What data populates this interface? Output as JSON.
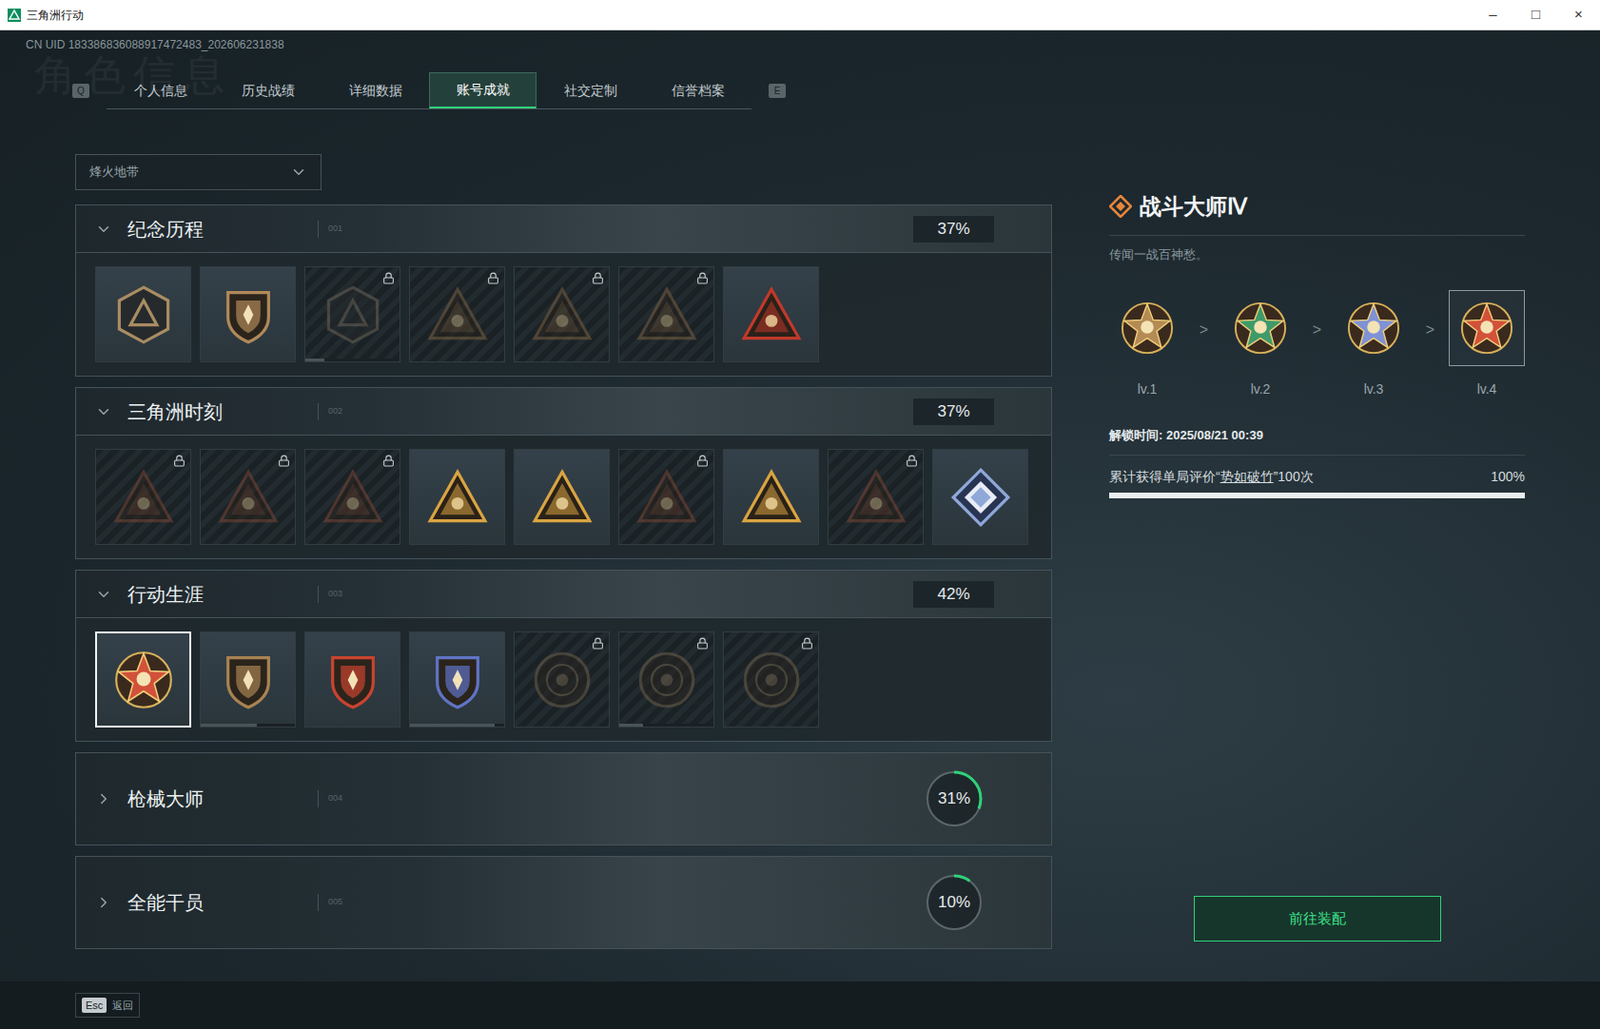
{
  "window": {
    "title": "三角洲行动",
    "controls": [
      "–",
      "□",
      "×"
    ]
  },
  "uid": "CN UID 183386836088917472483_202606231838",
  "watermark": "角色信息",
  "tabs": {
    "prev_key": "Q",
    "next_key": "E",
    "items": [
      {
        "label": "个人信息",
        "selected": false
      },
      {
        "label": "历史战绩",
        "selected": false
      },
      {
        "label": "详细数据",
        "selected": false
      },
      {
        "label": "账号成就",
        "selected": true
      },
      {
        "label": "社交定制",
        "selected": false
      },
      {
        "label": "信誉档案",
        "selected": false
      }
    ]
  },
  "mode_select": {
    "value": "烽火地带"
  },
  "sections": [
    {
      "title": "纪念历程",
      "code": "001",
      "percent": "37%",
      "expanded": true,
      "badges": [
        {
          "kind": "hex",
          "color": "#a98c62",
          "locked": false,
          "selected": false
        },
        {
          "kind": "shield",
          "color": "#b0895a",
          "locked": false,
          "selected": false
        },
        {
          "kind": "hex",
          "color": "#7a6e5e",
          "locked": true,
          "selected": false,
          "level": 0.2
        },
        {
          "kind": "triangle",
          "color": "#8a6a45",
          "locked": true,
          "selected": false
        },
        {
          "kind": "triangle",
          "color": "#8a6a45",
          "locked": true,
          "selected": false
        },
        {
          "kind": "triangle",
          "color": "#8a6a45",
          "locked": true,
          "selected": false
        },
        {
          "kind": "triangle",
          "color": "#c0392b",
          "locked": false,
          "selected": false
        }
      ]
    },
    {
      "title": "三角洲时刻",
      "code": "002",
      "percent": "37%",
      "expanded": true,
      "badges": [
        {
          "kind": "triangle",
          "color": "#8a4a35",
          "locked": true,
          "selected": false
        },
        {
          "kind": "triangle",
          "color": "#8a4a35",
          "locked": true,
          "selected": false
        },
        {
          "kind": "triangle",
          "color": "#8a4a35",
          "locked": true,
          "selected": false
        },
        {
          "kind": "triangle",
          "color": "#d9a441",
          "locked": false,
          "selected": false
        },
        {
          "kind": "triangle",
          "color": "#d9a441",
          "locked": false,
          "selected": false
        },
        {
          "kind": "triangle",
          "color": "#8a4a35",
          "locked": true,
          "selected": false
        },
        {
          "kind": "triangle",
          "color": "#d9a441",
          "locked": false,
          "selected": false
        },
        {
          "kind": "triangle",
          "color": "#8a4a35",
          "locked": true,
          "selected": false
        },
        {
          "kind": "diamond",
          "color": "#8fa8d8",
          "locked": false,
          "selected": false
        }
      ]
    },
    {
      "title": "行动生涯",
      "code": "003",
      "percent": "42%",
      "expanded": true,
      "badges": [
        {
          "kind": "star",
          "color": "#d2513a",
          "locked": false,
          "selected": true
        },
        {
          "kind": "shield",
          "color": "#a88352",
          "locked": false,
          "selected": false,
          "level": 0.6
        },
        {
          "kind": "shield",
          "color": "#c9432f",
          "locked": false,
          "selected": false
        },
        {
          "kind": "shield",
          "color": "#5f74c4",
          "locked": false,
          "selected": false,
          "level": 0.9
        },
        {
          "kind": "round",
          "color": "#7b6a4f",
          "locked": true,
          "selected": false
        },
        {
          "kind": "round",
          "color": "#7b6a4f",
          "locked": true,
          "selected": false,
          "level": 0.25
        },
        {
          "kind": "round",
          "color": "#7b6a4f",
          "locked": true,
          "selected": false
        }
      ]
    },
    {
      "title": "枪械大师",
      "code": "004",
      "percent": "31%",
      "expanded": false,
      "level": 0.31,
      "badges": []
    },
    {
      "title": "全能干员",
      "code": "005",
      "percent": "10%",
      "expanded": false,
      "level": 0.1,
      "badges": []
    }
  ],
  "detail": {
    "title": "战斗大师Ⅳ",
    "subtitle": "传闻一战百神愁。",
    "separator": ">",
    "levels": [
      {
        "label": "lv.1",
        "color": "#b48a55",
        "selected": false
      },
      {
        "label": "lv.2",
        "color": "#3f9a6a",
        "selected": false
      },
      {
        "label": "lv.3",
        "color": "#7f92d6",
        "selected": false
      },
      {
        "label": "lv.4",
        "color": "#d2513a",
        "selected": true
      }
    ],
    "unlock_time": "解锁时间: 2025/08/21 00:39",
    "requirement": {
      "before": "累计获得单局评价“",
      "link": "势如破竹",
      "after": "”100次"
    },
    "percent": "100%",
    "level": 1
  },
  "equip_button": "前往装配",
  "footer": {
    "key": "Esc",
    "label": "返回"
  }
}
